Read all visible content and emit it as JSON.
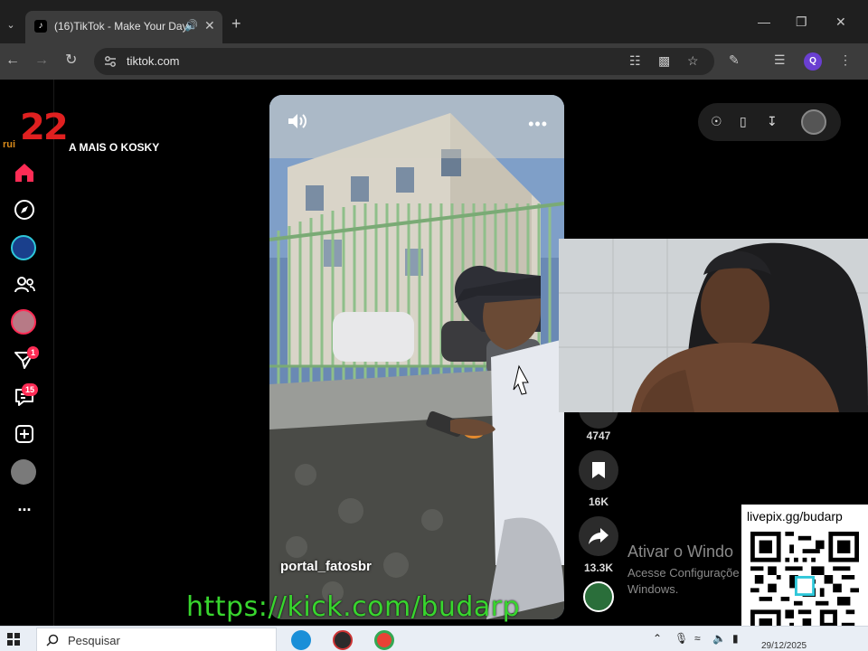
{
  "browser": {
    "tab_title": "(16)TikTok - Make Your Day",
    "url": "tiktok.com",
    "profile_initial": "Q"
  },
  "stream_overlay": {
    "logo_number": "22",
    "logo_small": "rui",
    "banner_text": "A MAIS O KOSKY",
    "kick_url": "https://kick.com/budarp",
    "qr_label": "livepix.gg/budarp"
  },
  "sidebar": {
    "items": [
      {
        "name": "home-icon"
      },
      {
        "name": "explore-icon"
      },
      {
        "name": "live-avatar"
      },
      {
        "name": "following-icon"
      },
      {
        "name": "friend-avatar"
      },
      {
        "name": "messages-icon",
        "badge": "1"
      },
      {
        "name": "inbox-icon",
        "badge": "15"
      },
      {
        "name": "upload-icon"
      },
      {
        "name": "profile-avatar"
      },
      {
        "name": "more-icon",
        "label": "..."
      }
    ]
  },
  "video": {
    "author": "portal_fatosbr"
  },
  "actions": {
    "comments_count": "4747",
    "saves_count": "16K",
    "shares_count": "13.3K"
  },
  "windows_watermark": {
    "line1": "Ativar o Windo",
    "line2a": "Acesse Configuraçõe",
    "line2b": "Windows."
  },
  "taskbar": {
    "search_placeholder": "Pesquisar",
    "clock": "29/12/2025"
  },
  "colors": {
    "tiktok_red": "#fe2c55",
    "kick_green": "#38d62e",
    "chrome_dark": "#1f1f1f"
  }
}
